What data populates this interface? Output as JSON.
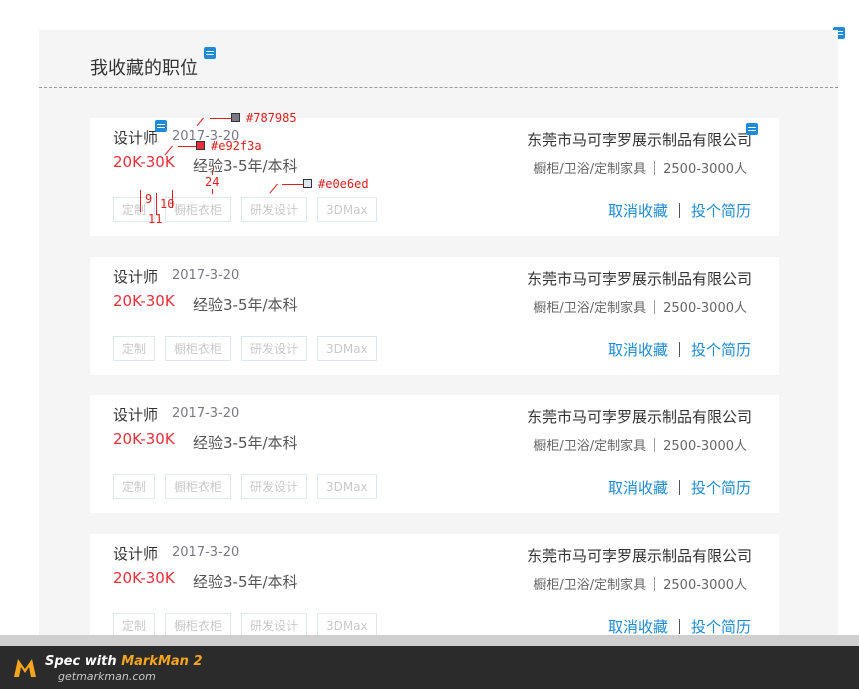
{
  "page": {
    "title": "我收藏的职位"
  },
  "colors": {
    "date": "#787985",
    "salary": "#e92f3a",
    "tag_border": "#e0e6ed",
    "link": "#1f8bd6"
  },
  "jobs": [
    {
      "title": "设计师",
      "date": "2017-3-20",
      "salary": "20K-30K",
      "experience": "经验3-5年/本科",
      "company": "东莞市马可孛罗展示制品有限公司",
      "industry": "橱柜/卫浴/定制家具",
      "size": "2500-3000人",
      "tags": [
        "定制",
        "橱柜衣柜",
        "研发设计",
        "3DMax"
      ],
      "cancel_label": "取消收藏",
      "apply_label": "投个简历"
    },
    {
      "title": "设计师",
      "date": "2017-3-20",
      "salary": "20K-30K",
      "experience": "经验3-5年/本科",
      "company": "东莞市马可孛罗展示制品有限公司",
      "industry": "橱柜/卫浴/定制家具",
      "size": "2500-3000人",
      "tags": [
        "定制",
        "橱柜衣柜",
        "研发设计",
        "3DMax"
      ],
      "cancel_label": "取消收藏",
      "apply_label": "投个简历"
    },
    {
      "title": "设计师",
      "date": "2017-3-20",
      "salary": "20K-30K",
      "experience": "经验3-5年/本科",
      "company": "东莞市马可孛罗展示制品有限公司",
      "industry": "橱柜/卫浴/定制家具",
      "size": "2500-3000人",
      "tags": [
        "定制",
        "橱柜衣柜",
        "研发设计",
        "3DMax"
      ],
      "cancel_label": "取消收藏",
      "apply_label": "投个简历"
    },
    {
      "title": "设计师",
      "date": "2017-3-20",
      "salary": "20K-30K",
      "experience": "经验3-5年/本科",
      "company": "东莞市马可孛罗展示制品有限公司",
      "industry": "橱柜/卫浴/定制家具",
      "size": "2500-3000人",
      "tags": [
        "定制",
        "橱柜衣柜",
        "研发设计",
        "3DMax"
      ],
      "cancel_label": "取消收藏",
      "apply_label": "投个简历"
    }
  ],
  "annotations": {
    "color_date": "#787985",
    "color_salary": "#e92f3a",
    "color_tag_border": "#e0e6ed",
    "measure_gap": "24",
    "measure_a": "9",
    "measure_b": "10",
    "measure_c": "11"
  },
  "footer": {
    "brand_prefix": "Spec with ",
    "brand_name": "MarkMan 2",
    "url": "getmarkman.com"
  }
}
